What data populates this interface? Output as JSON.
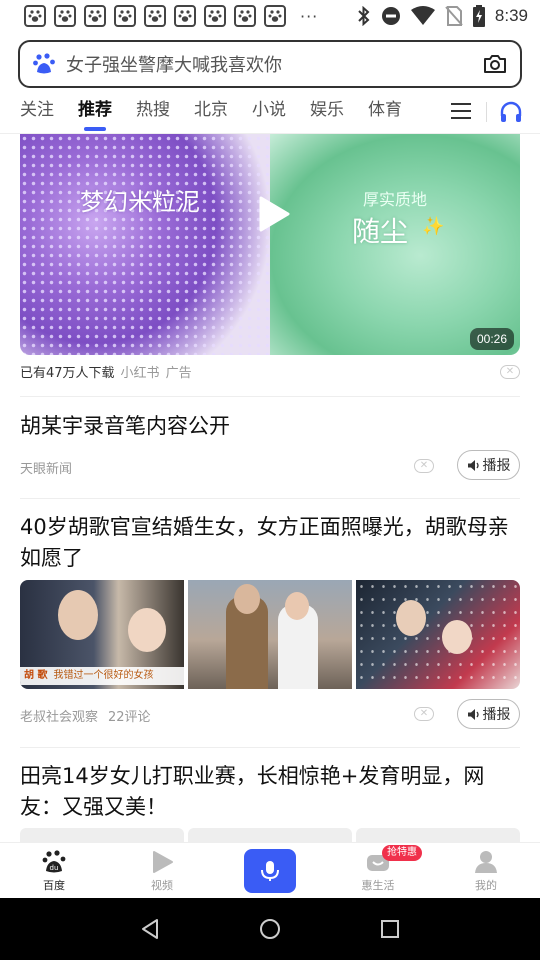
{
  "status_bar": {
    "time": "8:39",
    "overflow": "···"
  },
  "search": {
    "placeholder": "女子强坐警摩大喊我喜欢你"
  },
  "tabs": [
    {
      "label": "关注"
    },
    {
      "label": "推荐",
      "active": true
    },
    {
      "label": "热搜"
    },
    {
      "label": "北京"
    },
    {
      "label": "小说"
    },
    {
      "label": "娱乐"
    },
    {
      "label": "体育"
    }
  ],
  "ad": {
    "left_caption": "梦幻米粒泥",
    "right_caption_small": "厚实质地",
    "right_caption_big": "随尘",
    "duration": "00:26",
    "downloads": "已有47万人下载",
    "source": "小红书",
    "ad_label": "广告"
  },
  "articles": [
    {
      "title": "胡某宇录音笔内容公开",
      "source": "天眼新闻",
      "comments": "",
      "play_label": "播报"
    },
    {
      "title": "40岁胡歌官宣结婚生女，女方正面照曝光，胡歌母亲如愿了",
      "source": "老叔社会观察",
      "comments": "22评论",
      "play_label": "播报",
      "image_caption_1": "胡 歌",
      "image_caption_2": "我错过一个很好的女孩"
    },
    {
      "title": "田亮14岁女儿打职业赛，长相惊艳+发育明显，网友：又强又美！"
    }
  ],
  "bottom_nav": [
    {
      "label": "百度",
      "active": true
    },
    {
      "label": "视频"
    },
    {
      "label": ""
    },
    {
      "label": "惠生活",
      "badge": "抢特惠"
    },
    {
      "label": "我的"
    }
  ],
  "colors": {
    "accent": "#3a5cf5",
    "badge": "#f0304b"
  }
}
